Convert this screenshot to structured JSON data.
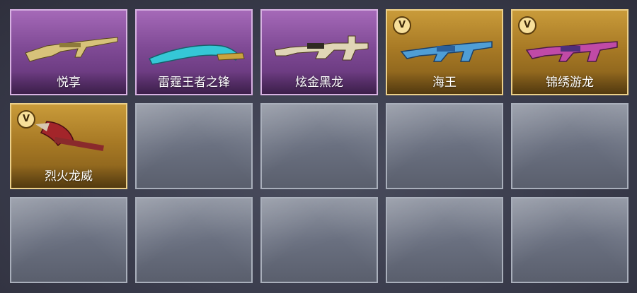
{
  "inventory": {
    "slots": [
      {
        "name": "悦享",
        "rarity": "purple",
        "vip": false,
        "weapon_icon": "rifle-icon"
      },
      {
        "name": "雷霆王者之锋",
        "rarity": "purple",
        "vip": false,
        "weapon_icon": "blade-icon"
      },
      {
        "name": "炫金黑龙",
        "rarity": "purple",
        "vip": false,
        "weapon_icon": "rifle-icon"
      },
      {
        "name": "海王",
        "rarity": "gold",
        "vip": true,
        "weapon_icon": "rifle-icon"
      },
      {
        "name": "锦绣游龙",
        "rarity": "gold",
        "vip": true,
        "weapon_icon": "rifle-icon"
      },
      {
        "name": "烈火龙威",
        "rarity": "gold",
        "vip": true,
        "weapon_icon": "axe-icon"
      },
      {
        "name": "",
        "rarity": "empty"
      },
      {
        "name": "",
        "rarity": "empty"
      },
      {
        "name": "",
        "rarity": "empty"
      },
      {
        "name": "",
        "rarity": "empty"
      },
      {
        "name": "",
        "rarity": "empty"
      },
      {
        "name": "",
        "rarity": "empty"
      },
      {
        "name": "",
        "rarity": "empty"
      },
      {
        "name": "",
        "rarity": "empty"
      },
      {
        "name": "",
        "rarity": "empty"
      }
    ],
    "vip_badge": "V",
    "colors": {
      "purple": "#7f4a95",
      "gold": "#a87a25",
      "empty": "#6a7080"
    }
  }
}
